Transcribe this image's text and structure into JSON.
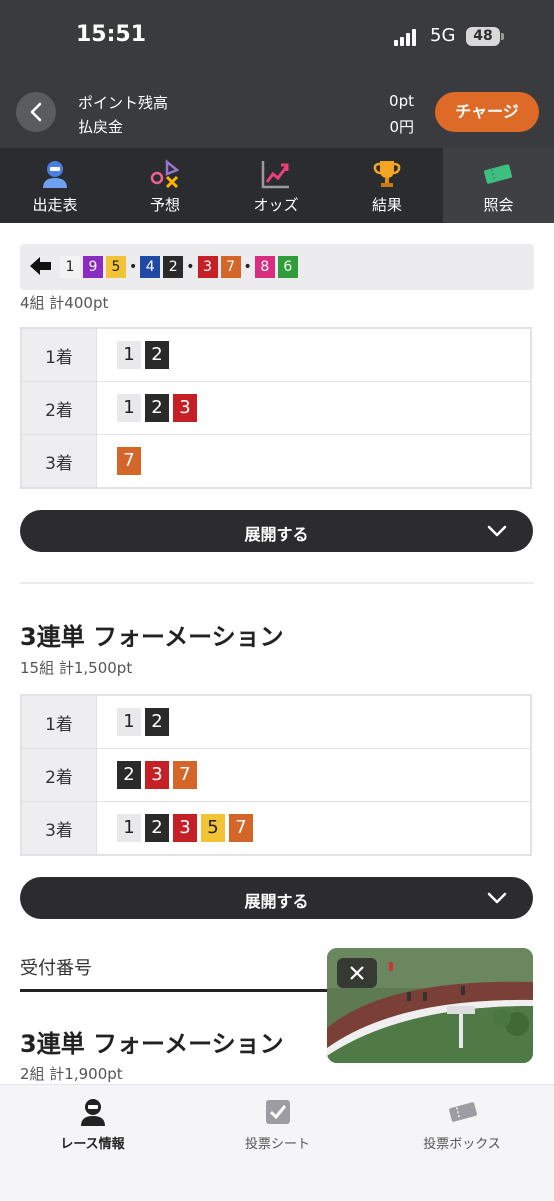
{
  "status_bar": {
    "time": "15:51",
    "network": "5G",
    "battery": "48"
  },
  "header": {
    "points_label": "ポイント残高",
    "refund_label": "払戻金",
    "points_value": "0pt",
    "refund_value": "0円",
    "charge_label": "チャージ"
  },
  "tabs": [
    {
      "label": "出走表",
      "icon": "runner-icon"
    },
    {
      "label": "予想",
      "icon": "prediction-icon"
    },
    {
      "label": "オッズ",
      "icon": "odds-chart-icon"
    },
    {
      "label": "結果",
      "icon": "trophy-icon"
    },
    {
      "label": "照会",
      "icon": "ticket-icon",
      "active": true
    }
  ],
  "strip": {
    "items": [
      {
        "t": "1",
        "bg": "#f3f3f3",
        "fg": "#222"
      },
      {
        "t": "9",
        "bg": "#8a2bc1",
        "fg": "#fff"
      },
      {
        "t": "5",
        "bg": "#f2c335",
        "fg": "#222"
      },
      {
        "t": "•"
      },
      {
        "t": "4",
        "bg": "#1e4aa6",
        "fg": "#fff"
      },
      {
        "t": "2",
        "bg": "#2a2a2a",
        "fg": "#fff"
      },
      {
        "t": "•"
      },
      {
        "t": "3",
        "bg": "#c42026",
        "fg": "#fff"
      },
      {
        "t": "7",
        "bg": "#d4662a",
        "fg": "#fff"
      },
      {
        "t": "•"
      },
      {
        "t": "8",
        "bg": "#d92e80",
        "fg": "#fff"
      },
      {
        "t": "6",
        "bg": "#2e9d3a",
        "fg": "#fff"
      }
    ]
  },
  "section1": {
    "summary": "4組 計400pt",
    "rows": [
      {
        "rank": "1着",
        "nums": [
          "1",
          "2"
        ]
      },
      {
        "rank": "2着",
        "nums": [
          "1",
          "2",
          "3"
        ]
      },
      {
        "rank": "3着",
        "nums": [
          "7"
        ]
      }
    ],
    "expand_label": "展開する"
  },
  "section2": {
    "title": "3連単 フォーメーション",
    "summary": "15組 計1,500pt",
    "rows": [
      {
        "rank": "1着",
        "nums": [
          "1",
          "2"
        ]
      },
      {
        "rank": "2着",
        "nums": [
          "2",
          "3",
          "7"
        ]
      },
      {
        "rank": "3着",
        "nums": [
          "1",
          "2",
          "3",
          "5",
          "7"
        ]
      }
    ],
    "expand_label": "展開する"
  },
  "accept_label": "受付番号",
  "section3": {
    "title": "3連単 フォーメーション",
    "summary": "2組 計1,900pt"
  },
  "number_colors": {
    "1": {
      "bg": "#e9e9ec",
      "fg": "#222"
    },
    "2": {
      "bg": "#2a2a2a",
      "fg": "#fff"
    },
    "3": {
      "bg": "#c42026",
      "fg": "#fff"
    },
    "5": {
      "bg": "#f2c335",
      "fg": "#222"
    },
    "7": {
      "bg": "#d4662a",
      "fg": "#fff"
    }
  },
  "bottom_nav": [
    {
      "label": "レース情報",
      "icon": "racer-icon",
      "active": true
    },
    {
      "label": "投票シート",
      "icon": "checkbox-sheet-icon"
    },
    {
      "label": "投票ボックス",
      "icon": "tickets-box-icon"
    }
  ]
}
